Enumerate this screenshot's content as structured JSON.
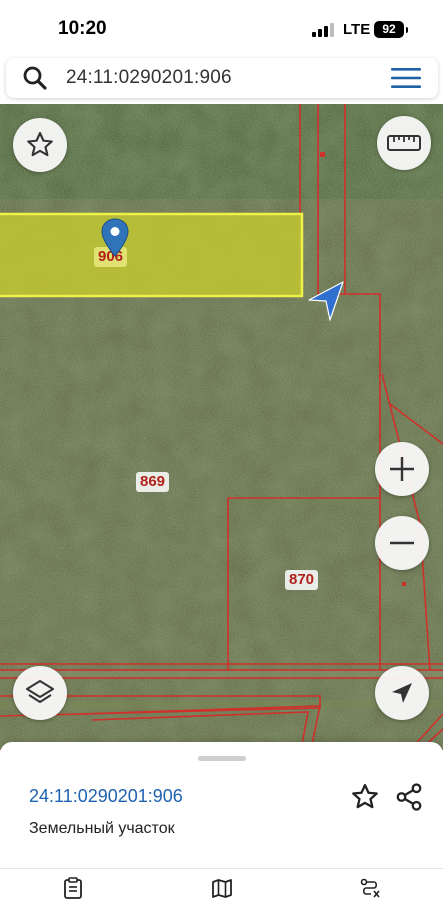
{
  "status_bar": {
    "time": "10:20",
    "network": "LTE",
    "battery": "92"
  },
  "search": {
    "value": "24:11:0290201:906",
    "icon": "search-icon",
    "menu_icon": "menu-icon"
  },
  "map": {
    "parcel_labels": {
      "selected": "906",
      "p869": "869",
      "p870": "870"
    },
    "colors": {
      "selected_fill": "#c8cd2e",
      "selected_border": "#f0f04a",
      "boundary": "#d0302a",
      "pin": "#2f74b8",
      "user_arrow": "#2f6fcf"
    },
    "controls": {
      "favorite": "star-icon",
      "ruler": "ruler-icon",
      "zoom_in": "plus-icon",
      "zoom_out": "minus-icon",
      "layers": "layers-icon",
      "locate": "location-arrow-icon"
    }
  },
  "sheet": {
    "parcel_number": "24:11:0290201:906",
    "parcel_type": "Земельный участок",
    "favorite_icon": "star-outline-icon",
    "share_icon": "share-icon"
  },
  "bottom_nav": {
    "items": [
      "clipboard-icon",
      "map-icon",
      "route-icon"
    ]
  }
}
